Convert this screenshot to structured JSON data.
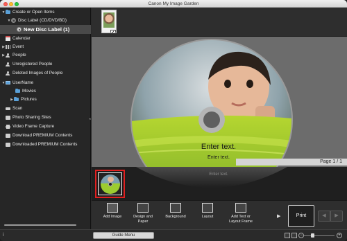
{
  "window": {
    "title": "Canon My Image Garden"
  },
  "sidebar": {
    "items": [
      {
        "label": "Create or Open Items",
        "icon": "folder-icon",
        "arrow": "▼"
      },
      {
        "label": "Disc Label (CD/DVD/BD)",
        "icon": "disc-icon",
        "arrow": "▼"
      },
      {
        "label": "New Disc Label (1)",
        "icon": "disc-icon",
        "arrow": ""
      },
      {
        "label": "Calendar",
        "icon": "calendar-icon",
        "arrow": ""
      },
      {
        "label": "Event",
        "icon": "event-icon",
        "arrow": "▶"
      },
      {
        "label": "People",
        "icon": "people-icon",
        "arrow": "▶"
      },
      {
        "label": "Unregistered People",
        "icon": "people-icon",
        "arrow": ""
      },
      {
        "label": "Deleted Images of People",
        "icon": "people-icon",
        "arrow": ""
      },
      {
        "label": "UserName",
        "icon": "computer-icon",
        "arrow": "▼"
      },
      {
        "label": "Movies",
        "icon": "folder-icon",
        "arrow": ""
      },
      {
        "label": "Pictures",
        "icon": "folder-icon",
        "arrow": "▶"
      },
      {
        "label": "Scan",
        "icon": "scan-icon",
        "arrow": ""
      },
      {
        "label": "Photo Sharing Sites",
        "icon": "share-icon",
        "arrow": ""
      },
      {
        "label": "Video Frame Capture",
        "icon": "film-icon",
        "arrow": ""
      },
      {
        "label": "Download PREMIUM Contents",
        "icon": "download-icon",
        "arrow": ""
      },
      {
        "label": "Downloaded PREMIUM Contents",
        "icon": "download-icon",
        "arrow": ""
      }
    ]
  },
  "editor": {
    "disc_text_main": "Enter text.",
    "disc_text_sub": "Enter text.",
    "reflection_text": "Enter text.",
    "page_indicator": "Page 1 / 1"
  },
  "toolbar": {
    "buttons": [
      {
        "label": "Add Image"
      },
      {
        "label": "Design and Paper"
      },
      {
        "label": "Background"
      },
      {
        "label": "Layout"
      },
      {
        "label": "Add Text or Layout Frame"
      }
    ],
    "print_label": "Print",
    "prev_label": "◀",
    "next_label": "▶"
  },
  "statusbar": {
    "guide_menu_label": "Guide Menu",
    "zoom_minus": "−",
    "zoom_plus": "+"
  },
  "colors": {
    "selection_border": "#e02020",
    "disc_green": "#9ccc30",
    "canvas_gray": "#6c6c6c"
  }
}
